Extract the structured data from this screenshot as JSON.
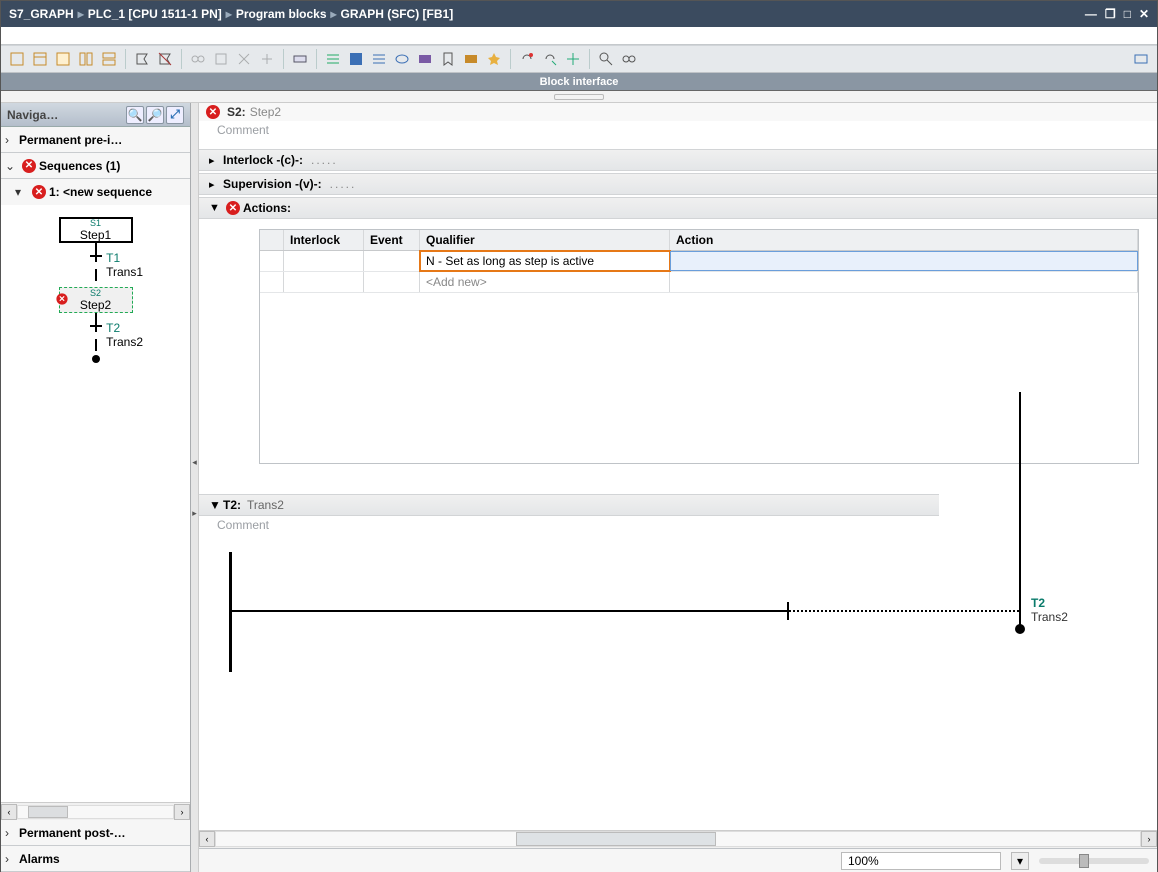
{
  "titlebar": {
    "crumbs": [
      "S7_GRAPH",
      "PLC_1 [CPU 1511-1 PN]",
      "Program blocks",
      "GRAPH (SFC) [FB1]"
    ]
  },
  "block_interface": "Block interface",
  "nav": {
    "title": "Naviga…",
    "pre": "Permanent pre-i…",
    "sequences": "Sequences (1)",
    "seq1": "1: <new sequence",
    "s1_id": "S1",
    "s1_name": "Step1",
    "t1_id": "T1",
    "t1_name": "Trans1",
    "s2_id": "S2",
    "s2_name": "Step2",
    "t2_id": "T2",
    "t2_name": "Trans2",
    "post": "Permanent post-…",
    "alarms": "Alarms"
  },
  "main": {
    "step_id": "S2:",
    "step_name": "Step2",
    "comment": "Comment",
    "interlock": "Interlock -(c)-:",
    "supervision": "Supervision -(v)-:",
    "actions": "Actions:",
    "table": {
      "headers": {
        "interlock": "Interlock",
        "event": "Event",
        "qualifier": "Qualifier",
        "action": "Action"
      },
      "row1_qualifier": "N     - Set as long as step is active",
      "add": "<Add new>"
    },
    "t2_id": "T2:",
    "t2_name": "Trans2",
    "t2_comment": "Comment",
    "ladder_label_id": "T2",
    "ladder_label_name": "Trans2"
  },
  "status": {
    "zoom": "100%"
  }
}
